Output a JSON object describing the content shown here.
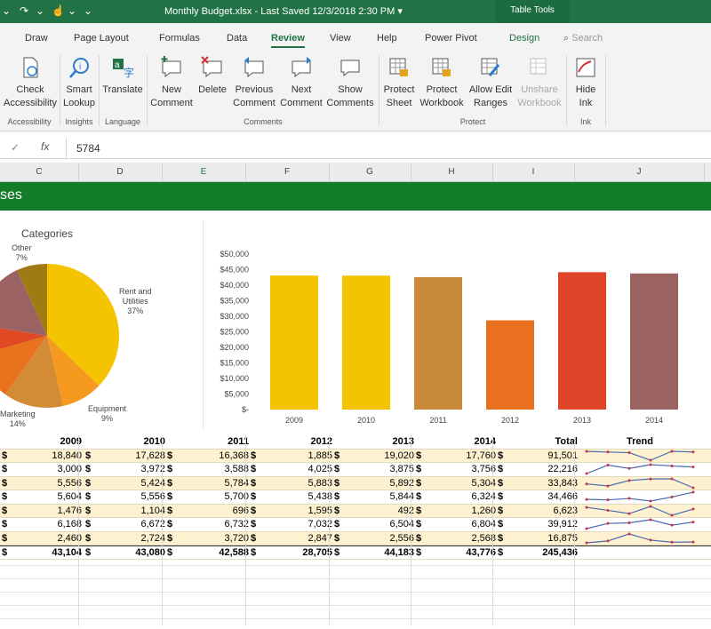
{
  "titlebar": {
    "filename": "Monthly Budget.xlsx",
    "saved": "Last Saved  12/3/2018  2:30 PM",
    "context": "Table Tools"
  },
  "tabs": [
    "Draw",
    "Page Layout",
    "Formulas",
    "Data",
    "Review",
    "View",
    "Help",
    "Power Pivot",
    "Design"
  ],
  "search": "Search",
  "ribbon": {
    "check": [
      "Check",
      "Accessibility"
    ],
    "smart": [
      "Smart",
      "Lookup"
    ],
    "translate": "Translate",
    "newc": [
      "New",
      "Comment"
    ],
    "del": "Delete",
    "prev": [
      "Previous",
      "Comment"
    ],
    "next": [
      "Next",
      "Comment"
    ],
    "show": [
      "Show",
      "Comments"
    ],
    "psheet": [
      "Protect",
      "Sheet"
    ],
    "pbook": [
      "Protect",
      "Workbook"
    ],
    "allow": [
      "Allow Edit",
      "Ranges"
    ],
    "unshare": [
      "Unshare",
      "Workbook"
    ],
    "hide": [
      "Hide",
      "Ink"
    ],
    "groups": [
      "Accessibility",
      "Insights",
      "Language",
      "Comments",
      "Protect",
      "Ink"
    ]
  },
  "formula": {
    "value": "5784",
    "fx": "fx"
  },
  "columns": [
    "C",
    "D",
    "E",
    "F",
    "G",
    "H",
    "I",
    "J"
  ],
  "banner": "ses",
  "pie": {
    "title": "Categories",
    "labels": [
      [
        "Other",
        "7%"
      ],
      [
        "Rent and",
        "Utilities",
        "37%"
      ],
      [
        "Equipment",
        "9%"
      ],
      [
        "Marketing",
        "14%"
      ]
    ]
  },
  "chart_data": {
    "type": "bar",
    "categories": [
      "2009",
      "2010",
      "2011",
      "2012",
      "2013",
      "2014"
    ],
    "values": [
      43104,
      43080,
      42588,
      28705,
      44183,
      43776
    ],
    "yticks": [
      "$50,000",
      "$45,000",
      "$40,000",
      "$35,000",
      "$30,000",
      "$25,000",
      "$20,000",
      "$15,000",
      "$10,000",
      "$5,000",
      "$-"
    ],
    "ylim": [
      0,
      50000
    ],
    "colors": [
      "#f5c400",
      "#f5c400",
      "#c98a3a",
      "#e8701e",
      "#e0452a",
      "#9b6262"
    ]
  },
  "table": {
    "headers": [
      "2009",
      "2010",
      "2011",
      "2012",
      "2013",
      "2014",
      "Total",
      "Trend"
    ],
    "currency": "$",
    "rows": [
      [
        "18,840",
        "17,628",
        "16,368",
        "1,885",
        "19,020",
        "17,760",
        "91,501"
      ],
      [
        "3,000",
        "3,972",
        "3,588",
        "4,025",
        "3,875",
        "3,756",
        "22,216"
      ],
      [
        "5,556",
        "5,424",
        "5,784",
        "5,883",
        "5,892",
        "5,304",
        "33,843"
      ],
      [
        "5,604",
        "5,556",
        "5,700",
        "5,438",
        "5,844",
        "6,324",
        "34,466"
      ],
      [
        "1,476",
        "1,104",
        "696",
        "1,595",
        "492",
        "1,260",
        "6,623"
      ],
      [
        "6,168",
        "6,672",
        "6,732",
        "7,032",
        "6,504",
        "6,804",
        "39,912"
      ],
      [
        "2,460",
        "2,724",
        "3,720",
        "2,847",
        "2,556",
        "2,568",
        "16,875"
      ]
    ],
    "totals": [
      "43,104",
      "43,080",
      "42,588",
      "28,705",
      "44,183",
      "43,776",
      "245,436"
    ]
  }
}
